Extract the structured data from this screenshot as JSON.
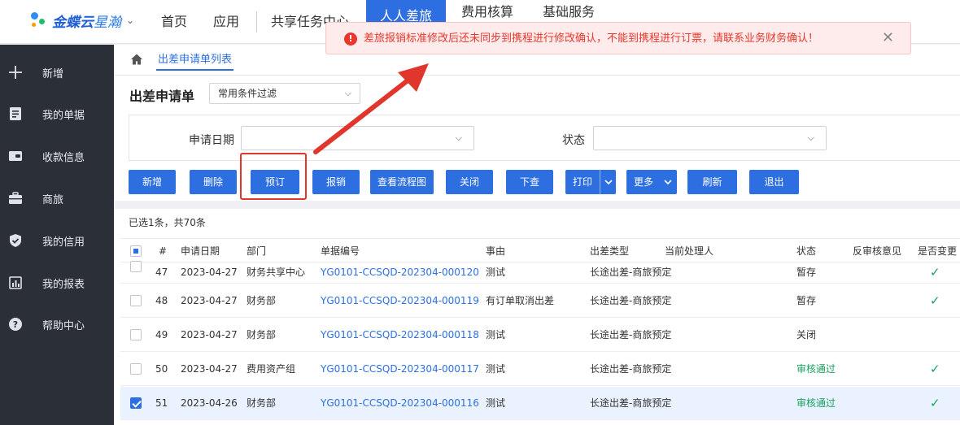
{
  "brand": {
    "name_bold": "金蝶云",
    "name_light": "星瀚"
  },
  "topnav": {
    "items": [
      "首页",
      "应用",
      "共享任务中心",
      "人人差旅",
      "费用核算",
      "基础服务"
    ],
    "active_index": 3
  },
  "sidebar": {
    "items": [
      {
        "label": "新增",
        "icon": "plus-icon"
      },
      {
        "label": "我的单据",
        "icon": "document-icon"
      },
      {
        "label": "收款信息",
        "icon": "wallet-icon"
      },
      {
        "label": "商旅",
        "icon": "briefcase-icon"
      },
      {
        "label": "我的信用",
        "icon": "shield-icon"
      },
      {
        "label": "我的报表",
        "icon": "report-icon"
      },
      {
        "label": "帮助中心",
        "icon": "help-icon"
      }
    ]
  },
  "breadcrumb": {
    "current": "出差申请单列表"
  },
  "page": {
    "title": "出差申请单",
    "filter_scheme": "常用条件过滤"
  },
  "filters": {
    "date_label": "申请日期",
    "status_label": "状态"
  },
  "toolbar": {
    "buttons": [
      "新增",
      "删除",
      "预订",
      "报销",
      "查看流程图",
      "关闭",
      "下查",
      "打印",
      "更多",
      "刷新",
      "退出"
    ]
  },
  "selection_info": "已选1条，共70条",
  "table": {
    "columns": [
      "#",
      "申请日期",
      "部门",
      "单据编号",
      "事由",
      "出差类型",
      "当前处理人",
      "状态",
      "反审核意见",
      "是否变更"
    ],
    "rows": [
      {
        "num": "47",
        "date": "2023-04-27",
        "dept": "财务共享中心",
        "code": "YG0101-CCSQD-202304-000120",
        "reason": "测试",
        "type": "长途出差-商旅预定",
        "handler": "",
        "status": "暂存",
        "status_color": "#333333",
        "changed": "✓",
        "checked": false
      },
      {
        "num": "48",
        "date": "2023-04-27",
        "dept": "财务部",
        "code": "YG0101-CCSQD-202304-000119",
        "reason": "有订单取消出差",
        "type": "长途出差-商旅预定",
        "handler": "",
        "status": "暂存",
        "status_color": "#333333",
        "changed": "✓",
        "checked": false
      },
      {
        "num": "49",
        "date": "2023-04-27",
        "dept": "财务部",
        "code": "YG0101-CCSQD-202304-000118",
        "reason": "测试",
        "type": "长途出差-商旅预定",
        "handler": "",
        "status": "关闭",
        "status_color": "#333333",
        "changed": "",
        "checked": false
      },
      {
        "num": "50",
        "date": "2023-04-27",
        "dept": "费用资产组",
        "code": "YG0101-CCSQD-202304-000117",
        "reason": "测试",
        "type": "长途出差-商旅预定",
        "handler": "",
        "status": "审核通过",
        "status_color": "#19a15f",
        "changed": "✓",
        "checked": false
      },
      {
        "num": "51",
        "date": "2023-04-26",
        "dept": "财务部",
        "code": "YG0101-CCSQD-202304-000116",
        "reason": "测试",
        "type": "长途出差-商旅预定",
        "handler": "",
        "status": "审核通过",
        "status_color": "#19a15f",
        "changed": "✓",
        "checked": true
      }
    ]
  },
  "toast": {
    "message": "差旅报销标准修改后还未同步到携程进行修改确认，不能到携程进行订票，请联系业务财务确认！",
    "type": "error",
    "color": "#e8372d"
  },
  "colors": {
    "accent": "#2d6fe0",
    "sidebar_bg": "#2b3038",
    "annotation": "#e0362c"
  }
}
